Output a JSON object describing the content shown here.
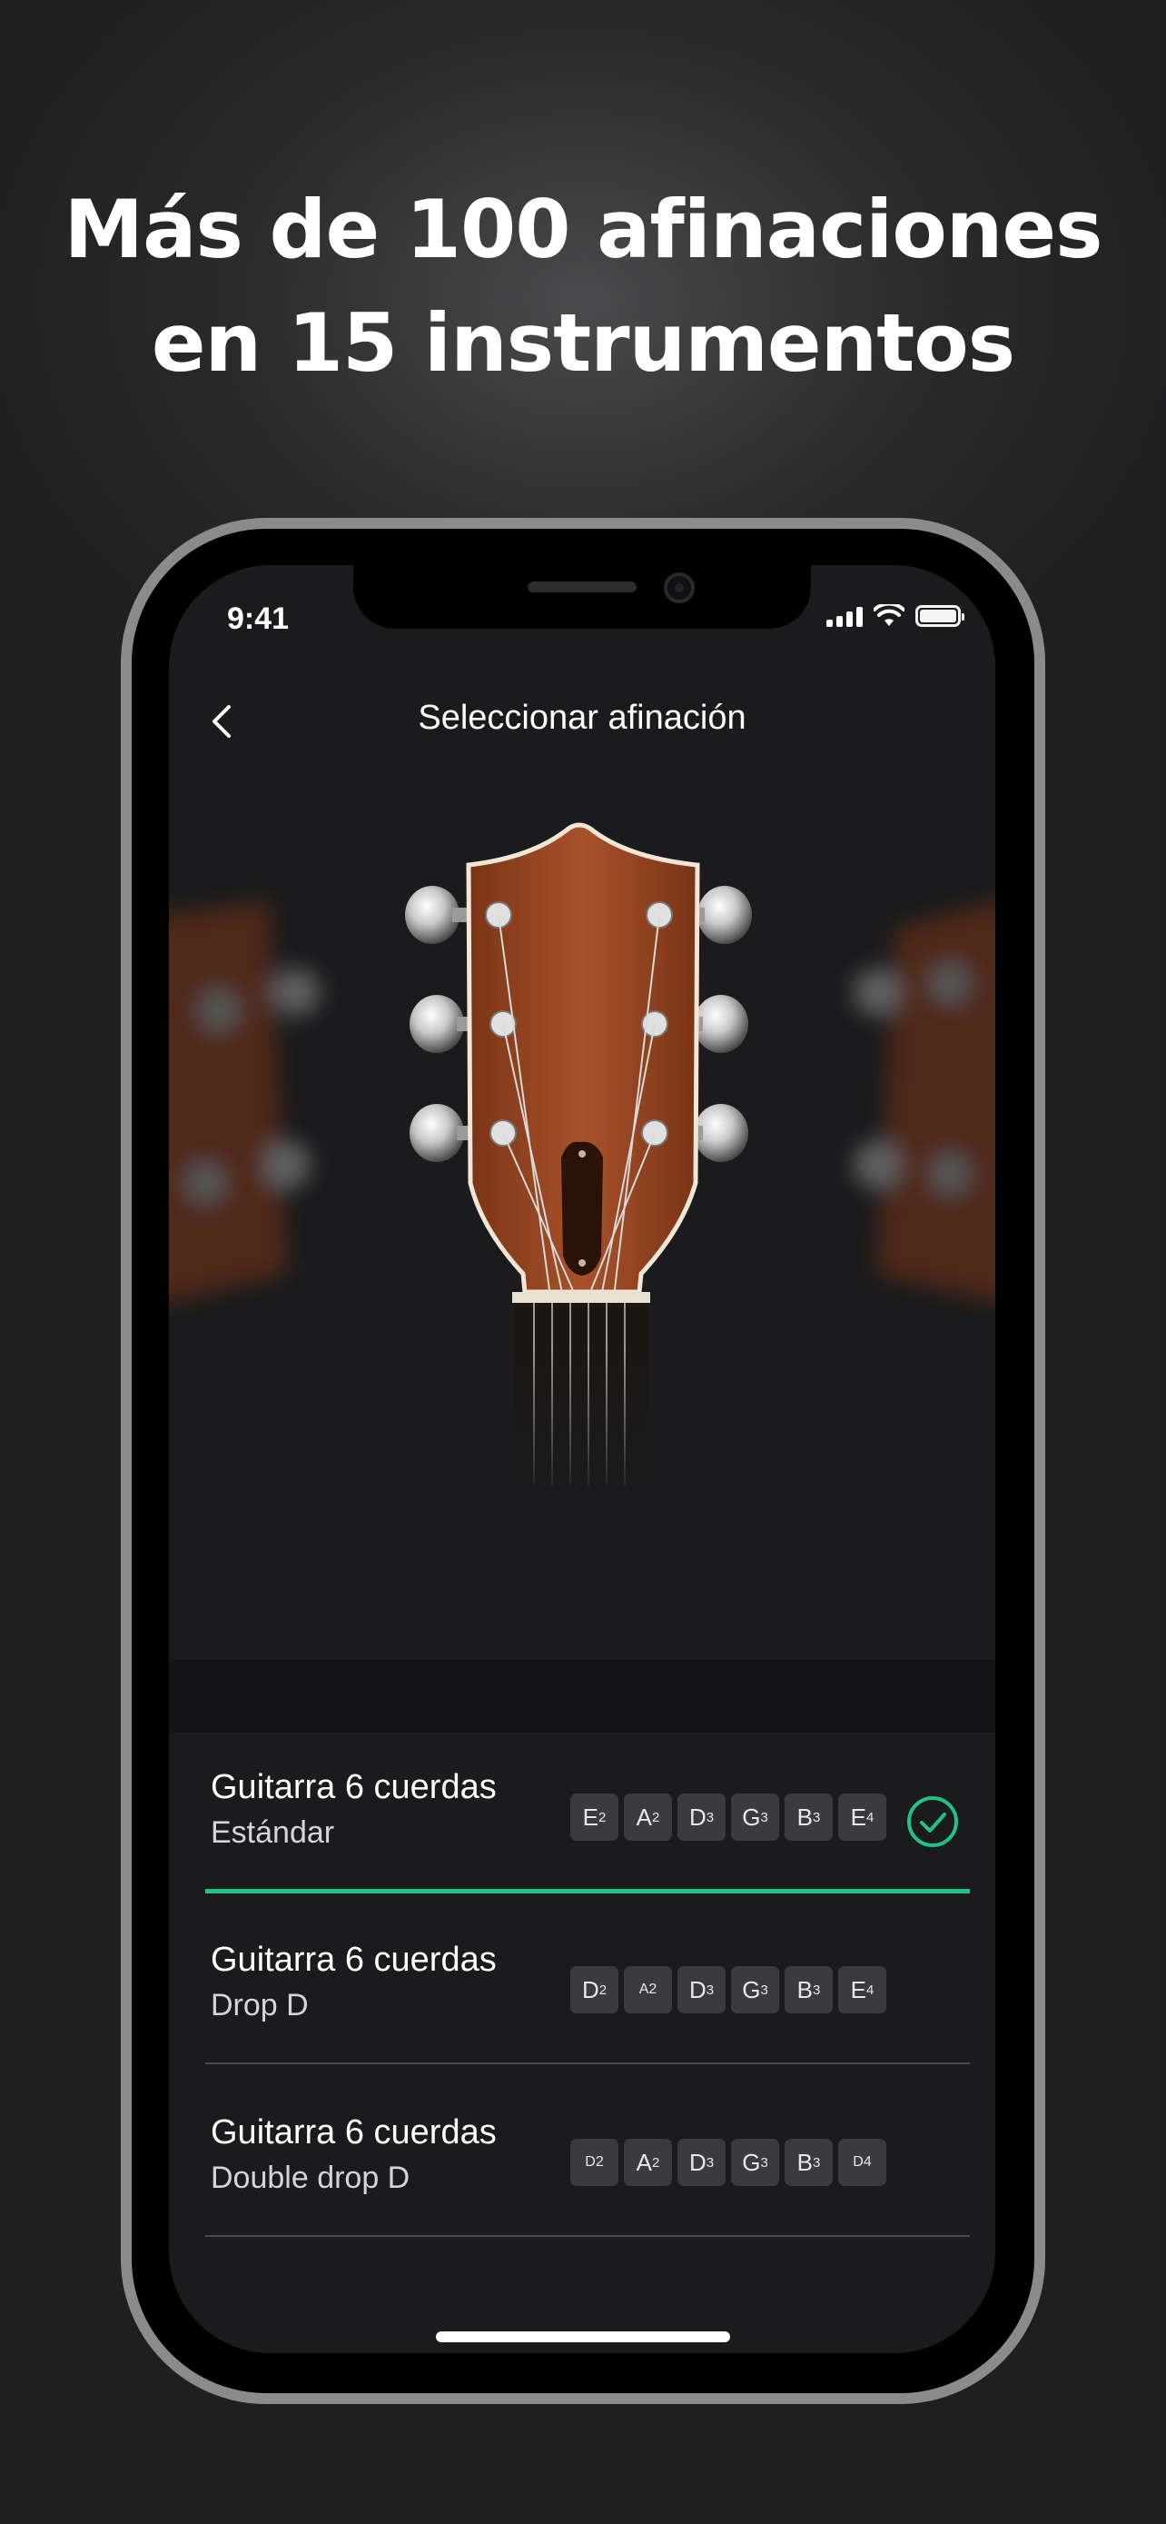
{
  "headline": {
    "line1": "Más de 100 afinaciones",
    "line2": "en 15 instrumentos"
  },
  "status_bar": {
    "time": "9:41",
    "icons": [
      "signal-icon",
      "wifi-icon",
      "battery-icon"
    ]
  },
  "nav": {
    "back_icon": "chevron-left-icon",
    "title": "Seleccionar afinación"
  },
  "hero": {
    "image": "guitar-headstock"
  },
  "accent_color": "#20c28a",
  "tunings": [
    {
      "title": "Guitarra 6 cuerdas",
      "subtitle": "Estándar",
      "selected": true,
      "notes": [
        {
          "note": "E",
          "octave": "2"
        },
        {
          "note": "A",
          "octave": "2"
        },
        {
          "note": "D",
          "octave": "3"
        },
        {
          "note": "G",
          "octave": "3"
        },
        {
          "note": "B",
          "octave": "3"
        },
        {
          "note": "E",
          "octave": "4"
        }
      ]
    },
    {
      "title": "Guitarra 6 cuerdas",
      "subtitle": "Drop D",
      "selected": false,
      "notes": [
        {
          "note": "D",
          "octave": "2"
        },
        {
          "note": "A2",
          "octave": "",
          "small": true
        },
        {
          "note": "D",
          "octave": "3"
        },
        {
          "note": "G",
          "octave": "3"
        },
        {
          "note": "B",
          "octave": "3"
        },
        {
          "note": "E",
          "octave": "4"
        }
      ]
    },
    {
      "title": "Guitarra 6 cuerdas",
      "subtitle": "Double drop D",
      "selected": false,
      "notes": [
        {
          "note": "D2",
          "octave": "",
          "small": true
        },
        {
          "note": "A",
          "octave": "2"
        },
        {
          "note": "D",
          "octave": "3"
        },
        {
          "note": "G",
          "octave": "3"
        },
        {
          "note": "B",
          "octave": "3"
        },
        {
          "note": "D4",
          "octave": "",
          "small": true
        }
      ]
    }
  ]
}
